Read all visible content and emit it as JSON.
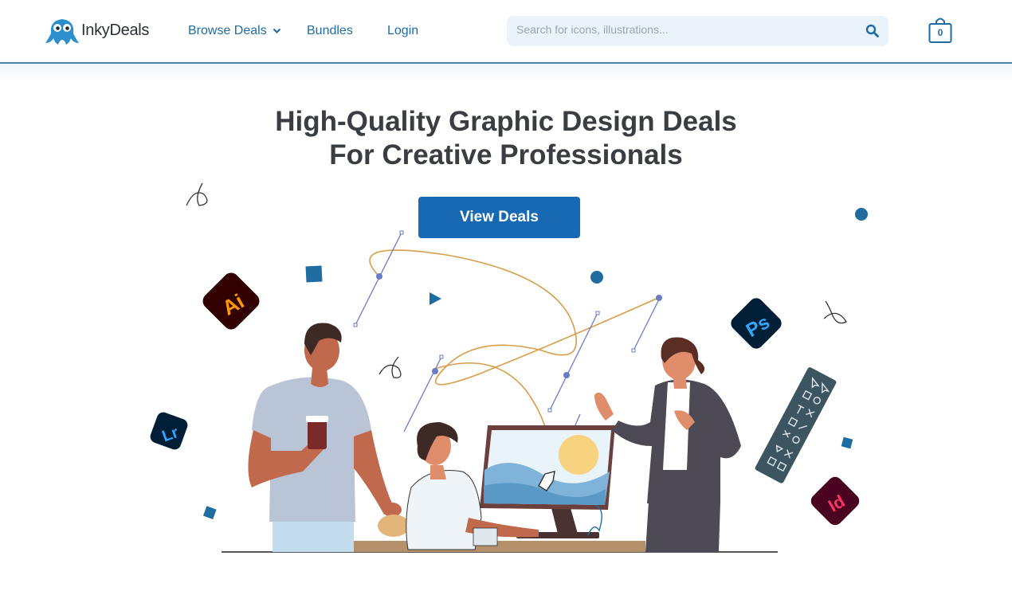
{
  "brand": {
    "name": "InkyDeals"
  },
  "nav": {
    "browse_label": "Browse Deals",
    "bundles_label": "Bundles",
    "login_label": "Login"
  },
  "search": {
    "placeholder": "Search for icons, illustrations..."
  },
  "cart": {
    "count": "0"
  },
  "hero": {
    "title_line1": "High-Quality Graphic Design Deals",
    "title_line2": "For Creative Professionals",
    "cta_label": "View Deals"
  },
  "app_badges": {
    "illustrator": "Ai",
    "photoshop": "Ps",
    "lightroom": "Lr",
    "indesign": "Id"
  },
  "colors": {
    "accent": "#1769b3",
    "nav_text": "#1f6ca1",
    "header_border": "#4a88b0",
    "search_bg": "#eaf3fa"
  }
}
